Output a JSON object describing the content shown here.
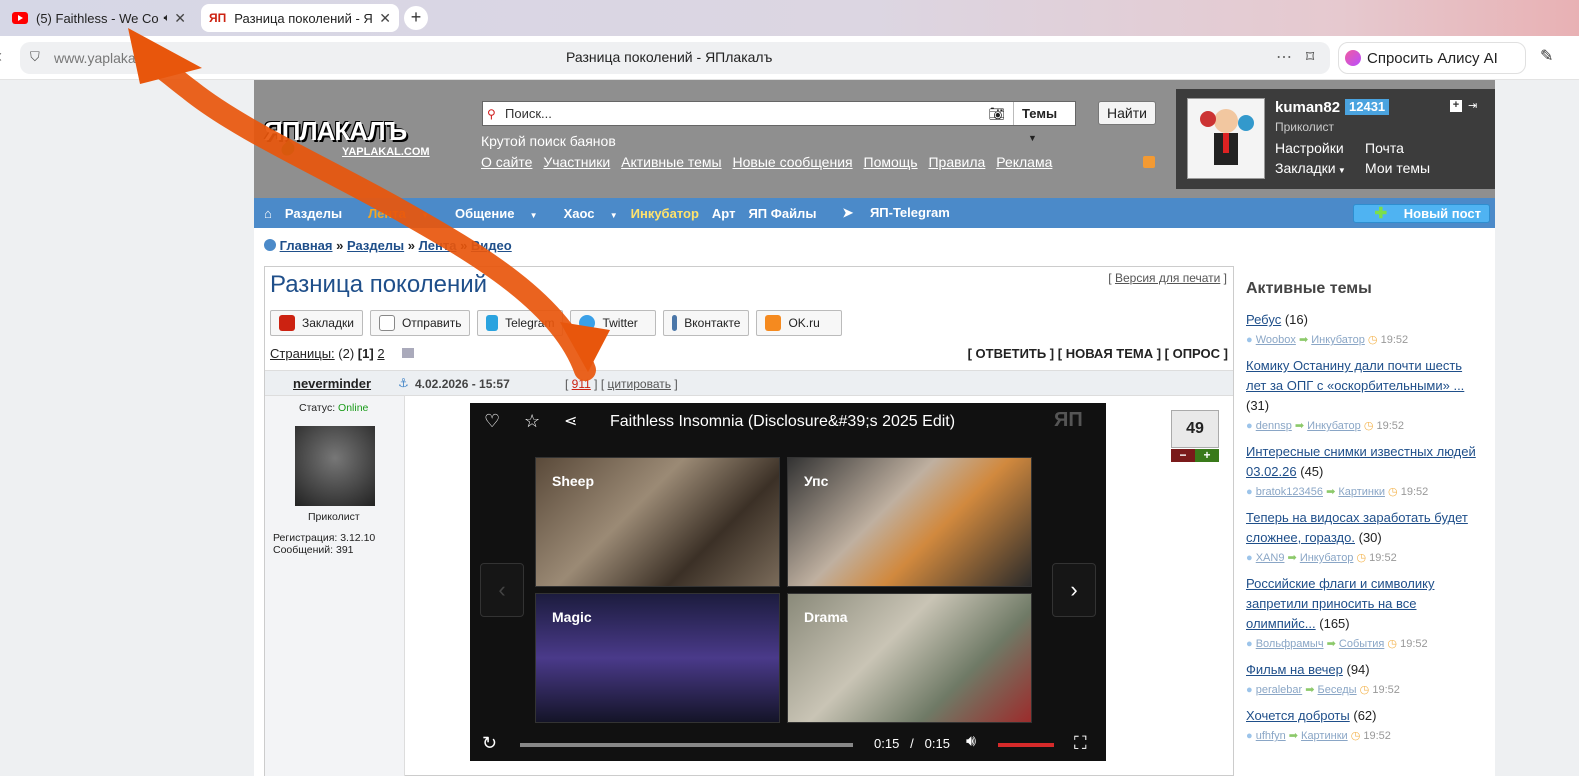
{
  "browser": {
    "tabs": [
      {
        "title": "(5) Faithless - We Co"
      },
      {
        "title": "Разница поколений - Я"
      }
    ],
    "new_tab": "+",
    "close": "✕",
    "address": "www.yaplakal.com",
    "page_title": "Разница поколений - ЯПлакалъ",
    "alice": "Спросить Алису AI"
  },
  "header": {
    "logo_main": "ЯПЛАКАЛЪ",
    "logo_sub": "YAPLAKAL.COM",
    "search_placeholder": "Поиск...",
    "search_scope": "Темы",
    "find": "Найти",
    "slogan": "Крутой поиск баянов",
    "links": [
      "О сайте",
      "Участники",
      "Активные темы",
      "Новые сообщения",
      "Помощь",
      "Правила",
      "Реклама"
    ]
  },
  "user": {
    "name": "kuman82",
    "count": "12431",
    "rank": "Приколист",
    "settings": "Настройки",
    "mail": "Почта",
    "bookmarks": "Закладки",
    "my_topics": "Мои темы"
  },
  "nav": {
    "home": "⌂",
    "items": [
      "Разделы",
      "Лента",
      "Общение",
      "Хаос",
      "Инкубатор",
      "Арт",
      "ЯП Файлы",
      "ЯП-Telegram"
    ],
    "new_post": "Новый пост"
  },
  "breadcrumbs": [
    "Главная",
    "Разделы",
    "Лента",
    "Видео"
  ],
  "topic": {
    "title": "Разница поколений",
    "print_version": "Версия для печати",
    "share": [
      "Закладки",
      "Отправить",
      "Telegram",
      "Twitter",
      "Вконтакте",
      "OK.ru"
    ],
    "pages_label": "Страницы:",
    "pages_count": "(2)",
    "page_current": "[1]",
    "page_next": "2",
    "actions": "[ ОТВЕТИТЬ ] [ НОВАЯ ТЕМА ] [ ОПРОС ]",
    "post": {
      "author": "neverminder",
      "date": "4.02.2026 - 15:57",
      "link_911": "911",
      "quote": "цитировать",
      "status_label": "Статус:",
      "status_value": "Online",
      "rank": "Приколист",
      "registered": "Регистрация: 3.12.10",
      "messages": "Сообщений: 391",
      "rating": "49",
      "minus": "−",
      "plus": "+"
    },
    "video": {
      "title": "Faithless Insomnia (Disclosure&#39;s 2025 Edit)",
      "suggestions": [
        "Sheep",
        "Упс",
        "Magic",
        "Drama"
      ],
      "time_current": "0:15",
      "time_sep": "/",
      "time_total": "0:15",
      "watermark": "ЯП"
    }
  },
  "sidebar": {
    "heading": "Активные темы",
    "items": [
      {
        "title": "Ребус",
        "count": "(16)",
        "user": "Woobox",
        "section": "Инкубатор",
        "time": "19:52"
      },
      {
        "title": "Комику Останину дали почти шесть лет за ОПГ с «оскорбительными» ...",
        "count": "(31)",
        "user": "dennsp",
        "section": "Инкубатор",
        "time": "19:52"
      },
      {
        "title": "Интересные снимки известных людей 03.02.26",
        "count": "(45)",
        "user": "bratok123456",
        "section": "Картинки",
        "time": "19:52"
      },
      {
        "title": "Теперь на видосах заработать будет сложнее, гораздо.",
        "count": "(30)",
        "user": "XAN9",
        "section": "Инкубатор",
        "time": "19:52"
      },
      {
        "title": "Российские флаги и символику запретили приносить на все олимпийс...",
        "count": "(165)",
        "user": "Вольфрамыч",
        "section": "События",
        "time": "19:52"
      },
      {
        "title": "Фильм на вечер",
        "count": "(94)",
        "user": "peralebar",
        "section": "Беседы",
        "time": "19:52"
      },
      {
        "title": "Хочется доброты",
        "count": "(62)",
        "user": "ufhfyn",
        "section": "Картинки",
        "time": "19:52"
      }
    ]
  },
  "colors": {
    "accent_nav": "#4b8ac9",
    "arrow": "#e8560c",
    "logo_red": "#e0262a"
  }
}
